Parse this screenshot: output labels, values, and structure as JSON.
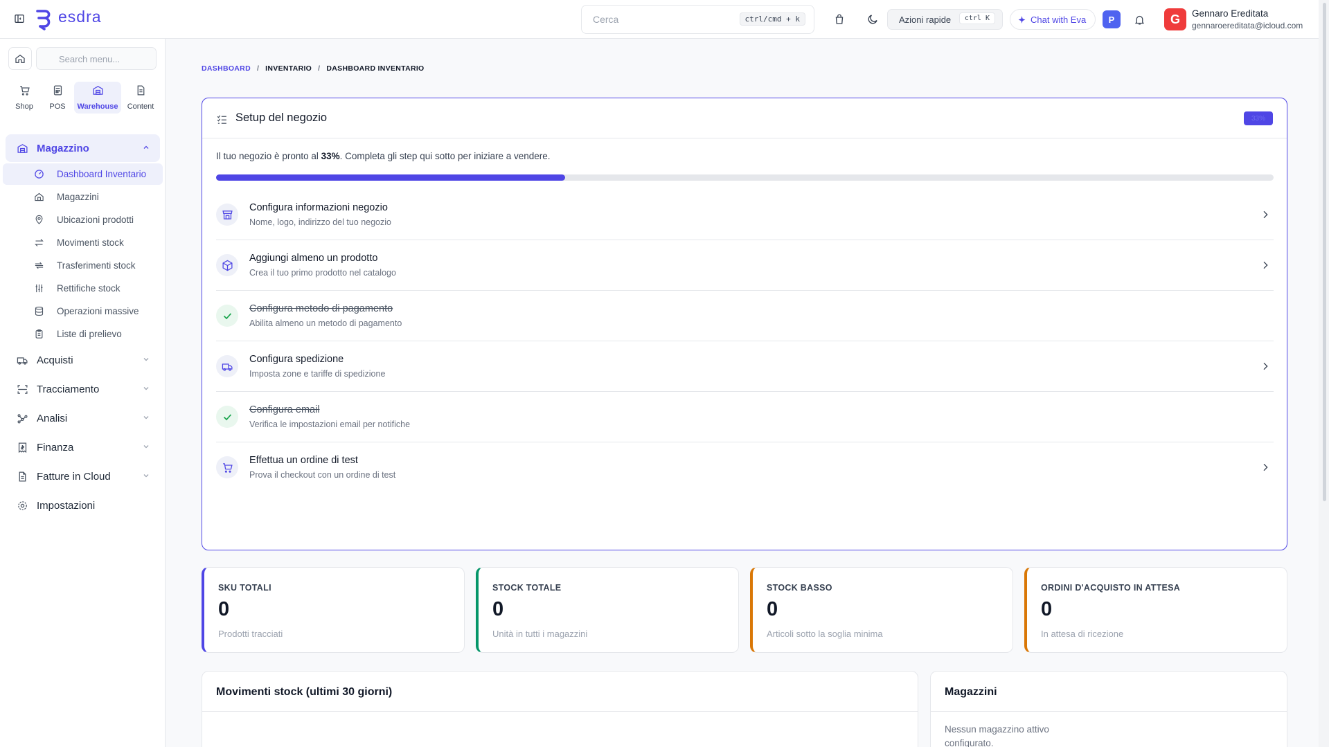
{
  "brand": {
    "name": "esdra",
    "accent": "#4f46e5"
  },
  "header": {
    "search_placeholder": "Cerca",
    "search_shortcut": "ctrl/cmd + k",
    "quick_actions_label": "Azioni rapide",
    "quick_actions_shortcut": "ctrl K",
    "chat_label": "Chat with Eva",
    "badge_letter": "P",
    "user": {
      "initial": "G",
      "name": "Gennaro Ereditata",
      "email": "gennaroereditata@icloud.com"
    }
  },
  "sidebar": {
    "search_placeholder": "Search menu...",
    "apps": [
      {
        "label": "Shop",
        "icon": "cart-icon"
      },
      {
        "label": "POS",
        "icon": "pos-icon"
      },
      {
        "label": "Warehouse",
        "icon": "warehouse-icon",
        "active": true
      },
      {
        "label": "Content",
        "icon": "document-icon"
      }
    ],
    "section_open": {
      "label": "Magazzino",
      "icon": "warehouse-icon"
    },
    "sub_items": [
      {
        "label": "Dashboard Inventario",
        "icon": "gauge-icon",
        "active": true
      },
      {
        "label": "Magazzini",
        "icon": "home-icon"
      },
      {
        "label": "Ubicazioni prodotti",
        "icon": "map-pin-icon"
      },
      {
        "label": "Movimenti stock",
        "icon": "arrows-left-right-icon"
      },
      {
        "label": "Trasferimenti stock",
        "icon": "transfer-icon"
      },
      {
        "label": "Rettifiche stock",
        "icon": "sliders-icon"
      },
      {
        "label": "Operazioni massive",
        "icon": "database-icon"
      },
      {
        "label": "Liste di prelievo",
        "icon": "clipboard-icon"
      }
    ],
    "sections": [
      {
        "label": "Acquisti",
        "icon": "truck-icon"
      },
      {
        "label": "Tracciamento",
        "icon": "scan-icon"
      },
      {
        "label": "Analisi",
        "icon": "analytics-icon"
      },
      {
        "label": "Finanza",
        "icon": "receipt-icon"
      },
      {
        "label": "Fatture in Cloud",
        "icon": "invoice-icon"
      },
      {
        "label": "Impostazioni",
        "icon": "gear-icon"
      }
    ]
  },
  "breadcrumb": [
    "DASHBOARD",
    "INVENTARIO",
    "DASHBOARD INVENTARIO"
  ],
  "setup": {
    "title": "Setup del negozio",
    "badge": "33%",
    "progress": 0.33,
    "intro_before": "Il tuo negozio è pronto al ",
    "intro_percent": "33%",
    "intro_after": ". Completa gli step qui sotto per iniziare a vendere.",
    "steps": [
      {
        "title": "Configura informazioni negozio",
        "desc": "Nome, logo, indirizzo del tuo negozio",
        "done": false,
        "icon": "store-icon"
      },
      {
        "title": "Aggiungi almeno un prodotto",
        "desc": "Crea il tuo primo prodotto nel catalogo",
        "done": false,
        "icon": "box-icon"
      },
      {
        "title": "Configura metodo di pagamento",
        "desc": "Abilita almeno un metodo di pagamento",
        "done": true,
        "icon": "check-icon"
      },
      {
        "title": "Configura spedizione",
        "desc": "Imposta zone e tariffe di spedizione",
        "done": false,
        "icon": "truck-icon"
      },
      {
        "title": "Configura email",
        "desc": "Verifica le impostazioni email per notifiche",
        "done": true,
        "icon": "check-icon"
      },
      {
        "title": "Effettua un ordine di test",
        "desc": "Prova il checkout con un ordine di test",
        "done": false,
        "icon": "cart-icon"
      }
    ]
  },
  "stats": [
    {
      "label": "SKU TOTALI",
      "value": "0",
      "desc": "Prodotti tracciati",
      "color": "#4f46e5"
    },
    {
      "label": "STOCK TOTALE",
      "value": "0",
      "desc": "Unità in tutti i magazzini",
      "color": "#059669"
    },
    {
      "label": "STOCK BASSO",
      "value": "0",
      "desc": "Articoli sotto la soglia minima",
      "color": "#d97706"
    },
    {
      "label": "ORDINI D'ACQUISTO IN ATTESA",
      "value": "0",
      "desc": "In attesa di ricezione",
      "color": "#d97706"
    }
  ],
  "panels": {
    "movements_title": "Movimenti stock (ultimi 30 giorni)",
    "warehouses_title": "Magazzini",
    "warehouses_empty_line1": "Nessun magazzino attivo",
    "warehouses_empty_line2": "configurato."
  }
}
